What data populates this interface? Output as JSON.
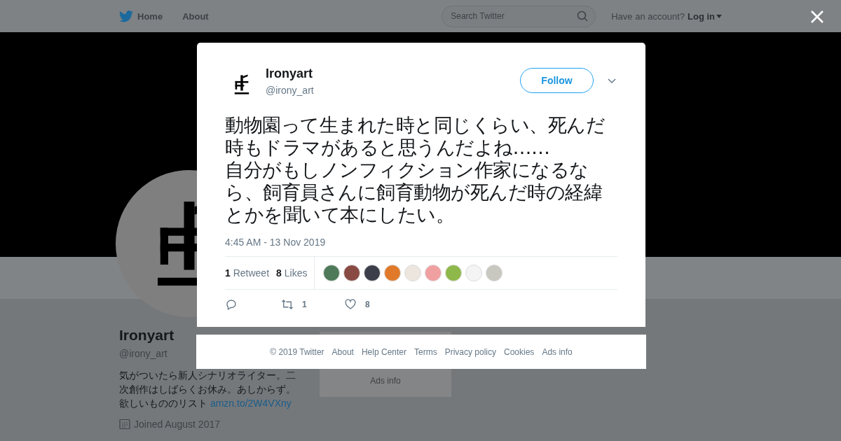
{
  "header": {
    "nav": [
      {
        "label": "Home",
        "kind": "home"
      },
      {
        "label": "About",
        "kind": "plain"
      }
    ],
    "search": {
      "placeholder": "Search Twitter"
    },
    "account_prompt": "Have an account?",
    "login": "Log in"
  },
  "profile": {
    "name": "Ironyart",
    "handle": "@irony_art",
    "bio": "気がついたら新人シナリオライター。二次創作はしばらくお休み。あしからず。欲しいもののリスト",
    "bio_link": "amzn.to/2W4VXny",
    "joined": "Joined August 2017"
  },
  "sidebar": {
    "links": [
      "Ads info"
    ]
  },
  "tweet": {
    "name": "Ironyart",
    "handle": "@irony_art",
    "follow_button": "Follow",
    "paragraphs": [
      "動物園って生まれた時と同じくらい、死んだ時もドラマがあると思うんだよね……",
      "自分がもしノンフィクション作家になるなら、飼育員さんに飼育動物が死んだ時の経緯とかを聞いて本にしたい。"
    ],
    "timestamp": "4:45 AM - 13 Nov 2019",
    "stats": [
      {
        "count": "1",
        "label": "Retweet"
      },
      {
        "count": "8",
        "label": "Likes"
      }
    ],
    "likers": [
      {
        "color": "#4f7a5a"
      },
      {
        "color": "#8a4a44"
      },
      {
        "color": "#3c3f4a"
      },
      {
        "color": "#e07a2a"
      },
      {
        "color": "#ece6de"
      },
      {
        "color": "#f0a0a0"
      },
      {
        "color": "#8fb84a"
      },
      {
        "color": "#f4f4f4"
      },
      {
        "color": "#c8c8c0"
      }
    ],
    "actions": [
      {
        "kind": "reply"
      },
      {
        "kind": "retweet",
        "count": "1"
      },
      {
        "kind": "like",
        "count": "8"
      }
    ]
  },
  "footer": [
    "© 2019 Twitter",
    "About",
    "Help Center",
    "Terms",
    "Privacy policy",
    "Cookies",
    "Ads info"
  ]
}
